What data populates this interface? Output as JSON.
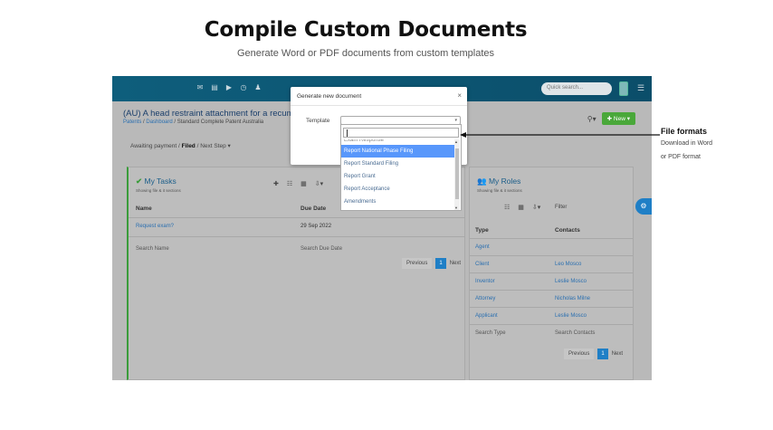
{
  "hero": {
    "title": "Compile Custom Documents",
    "subtitle": "Generate Word or PDF documents from custom templates"
  },
  "topbar": {
    "icons": [
      "envelope-icon",
      "card-icon",
      "play-icon",
      "clock-icon",
      "user-icon"
    ],
    "search_placeholder": "Quick search..."
  },
  "page": {
    "title": "(AU) A head restraint attachment for a recumbe",
    "breadcrumbs": [
      "Patents",
      "Dashboard",
      "Standard Complete Patent Australia"
    ],
    "new_button": "New",
    "status": {
      "previous": "Awaiting payment",
      "current": "Filed",
      "next": "Next Step"
    }
  },
  "tasks_panel": {
    "title": "My Tasks",
    "subtitle": "Showing file & it sections",
    "columns": [
      "Name",
      "Due Date"
    ],
    "rows": [
      {
        "name": "Request exam?",
        "due": "29 Sep 2022"
      }
    ],
    "filters": [
      "Search Name",
      "Search Due Date"
    ],
    "pager": {
      "prev": "Previous",
      "page": "1",
      "next": "Next"
    }
  },
  "roles_panel": {
    "title": "My Roles",
    "subtitle": "Showing file & it sections",
    "filter_label": "Filter",
    "columns": [
      "Type",
      "Contacts"
    ],
    "rows": [
      {
        "type": "Agent",
        "contact": ""
      },
      {
        "type": "Client",
        "contact": "Leo Mosco"
      },
      {
        "type": "Inventor",
        "contact": "Leslie Mosco"
      },
      {
        "type": "Attorney",
        "contact": "Nicholas Milne"
      },
      {
        "type": "Applicant",
        "contact": "Leslie Mosco"
      }
    ],
    "filters": [
      "Search Type",
      "Search Contacts"
    ],
    "pager": {
      "prev": "Previous",
      "page": "1",
      "next": "Next"
    }
  },
  "modal": {
    "title": "Generate new document",
    "close": "×",
    "template_label": "Template",
    "options": [
      {
        "label": "Exam Response",
        "state": "cut"
      },
      {
        "label": "Report National Phase Filing",
        "state": "highlighted"
      },
      {
        "label": "Report Standard Filing",
        "state": "normal"
      },
      {
        "label": "Report Grant",
        "state": "normal"
      },
      {
        "label": "Report Acceptance",
        "state": "normal"
      },
      {
        "label": "Amendments",
        "state": "normal"
      }
    ]
  },
  "callout": {
    "title": "File formats",
    "line1": "Download in Word",
    "line2": "or PDF format"
  },
  "colors": {
    "topbar": "#0e5e7c",
    "accent_green": "#4aa83a",
    "accent_blue": "#1f7fc6",
    "highlight": "#5897fb"
  }
}
